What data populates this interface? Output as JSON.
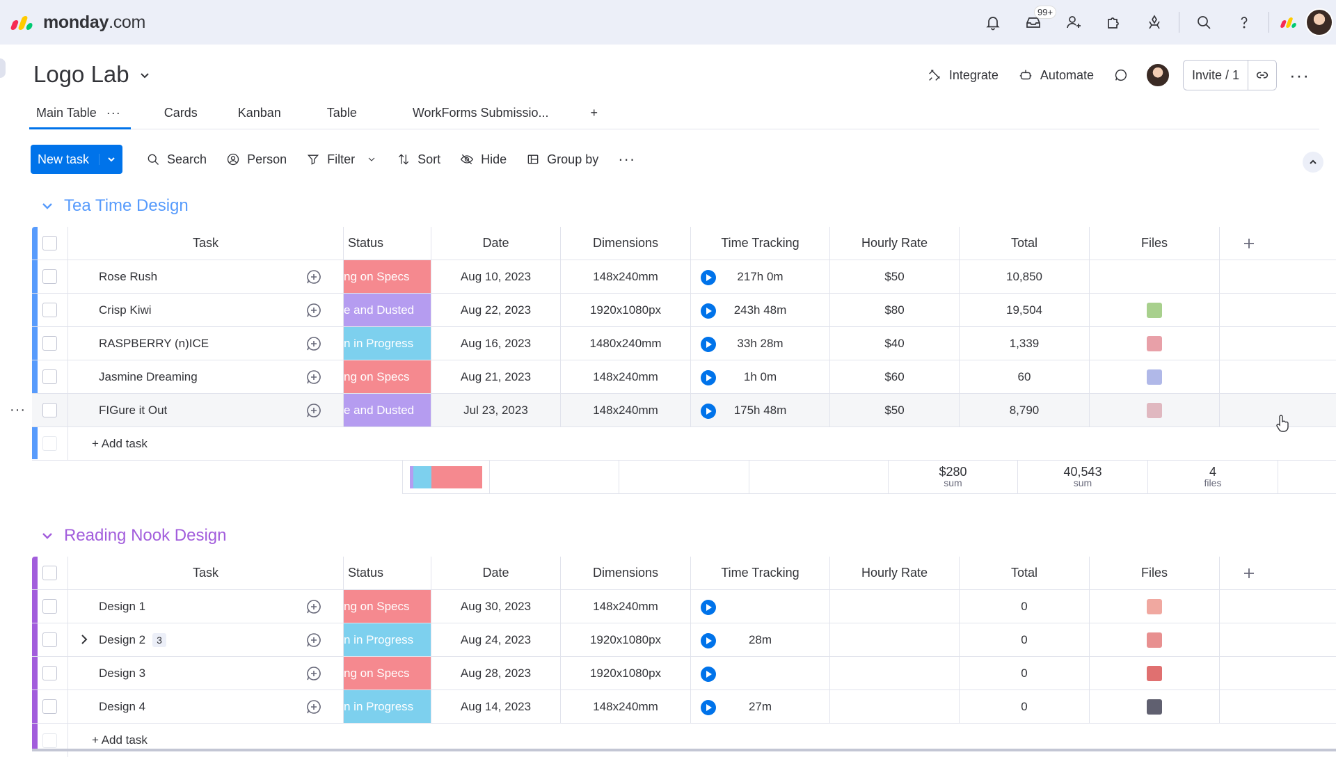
{
  "app": {
    "brand_bold": "monday",
    "brand_suffix": ".com",
    "brand_colors": [
      "#f62b54",
      "#ffcb00",
      "#00ca72"
    ],
    "notifications_badge": "99+"
  },
  "board": {
    "title": "Logo Lab",
    "actions": {
      "integrate": "Integrate",
      "automate": "Automate",
      "invite": "Invite / 1"
    },
    "tabs": [
      {
        "label": "Main Table",
        "more": "···"
      },
      {
        "label": "Cards"
      },
      {
        "label": "Kanban"
      },
      {
        "label": "Table"
      },
      {
        "label": "WorkForms Submissio..."
      }
    ],
    "tab_add": "+"
  },
  "toolbar": {
    "new_task": "New task",
    "search": "Search",
    "person": "Person",
    "filter": "Filter",
    "sort": "Sort",
    "hide": "Hide",
    "group_by": "Group by",
    "more": "···"
  },
  "columns": {
    "task": "Task",
    "status": "Status",
    "date": "Date",
    "dimensions": "Dimensions",
    "time_tracking": "Time Tracking",
    "hourly_rate": "Hourly Rate",
    "total": "Total",
    "files": "Files"
  },
  "status_colors": {
    "specs": "#f5898f",
    "dusted": "#b59cf0",
    "progress": "#7dd0ee"
  },
  "groups": [
    {
      "title": "Tea Time Design",
      "color": "#579bfc",
      "rows": [
        {
          "task": "Rose Rush",
          "status": "ng on Specs",
          "status_key": "specs",
          "date": "Aug 10, 2023",
          "dim": "148x240mm",
          "time": "217h 0m",
          "rate": "$50",
          "total": "10,850",
          "file_color": ""
        },
        {
          "task": "Crisp Kiwi",
          "status": "e and Dusted",
          "status_key": "dusted",
          "date": "Aug 22, 2023",
          "dim": "1920x1080px",
          "time": "243h 48m",
          "rate": "$80",
          "total": "19,504",
          "file_color": "#a8d08d"
        },
        {
          "task": "RASPBERRY (n)ICE",
          "status": "n in Progress",
          "status_key": "progress",
          "date": "Aug 16, 2023",
          "dim": "1480x240mm",
          "time": "33h 28m",
          "rate": "$40",
          "total": "1,339",
          "file_color": "#e8a0a8"
        },
        {
          "task": "Jasmine Dreaming",
          "status": "ng on Specs",
          "status_key": "specs",
          "date": "Aug 21, 2023",
          "dim": "148x240mm",
          "time": "1h 0m",
          "rate": "$60",
          "total": "60",
          "file_color": "#b0b8e8"
        },
        {
          "task": "FIGure it Out",
          "status": "e and Dusted",
          "status_key": "dusted",
          "date": "Jul 23, 2023",
          "dim": "148x240mm",
          "time": "175h 48m",
          "rate": "$50",
          "total": "8,790",
          "file_color": "#e0b8c0"
        }
      ],
      "add_task": "+ Add task",
      "summary": {
        "rate_value": "$280",
        "rate_label": "sum",
        "total_value": "40,543",
        "total_label": "sum",
        "files_value": "4",
        "files_label": "files",
        "status_mix": [
          {
            "color": "#b59cf0",
            "fraction": 0.05
          },
          {
            "color": "#7dd0ee",
            "fraction": 0.25
          },
          {
            "color": "#f5898f",
            "fraction": 0.7
          }
        ]
      }
    },
    {
      "title": "Reading Nook Design",
      "color": "#a25ddc",
      "rows": [
        {
          "task": "Design 1",
          "status": "ng on Specs",
          "status_key": "specs",
          "date": "Aug 30, 2023",
          "dim": "148x240mm",
          "time": "",
          "rate": "",
          "total": "0",
          "file_color": "#f0a8a0"
        },
        {
          "task": "Design 2",
          "subitems": "3",
          "status": "n in Progress",
          "status_key": "progress",
          "date": "Aug 24, 2023",
          "dim": "1920x1080px",
          "time": "28m",
          "rate": "",
          "total": "0",
          "file_color": "#e89090"
        },
        {
          "task": "Design 3",
          "status": "ng on Specs",
          "status_key": "specs",
          "date": "Aug 28, 2023",
          "dim": "1920x1080px",
          "time": "",
          "rate": "",
          "total": "0",
          "file_color": "#e07070"
        },
        {
          "task": "Design 4",
          "status": "n in Progress",
          "status_key": "progress",
          "date": "Aug 14, 2023",
          "dim": "148x240mm",
          "time": "27m",
          "rate": "",
          "total": "0",
          "file_color": "#606070"
        }
      ],
      "add_task": "+ Add task"
    }
  ]
}
